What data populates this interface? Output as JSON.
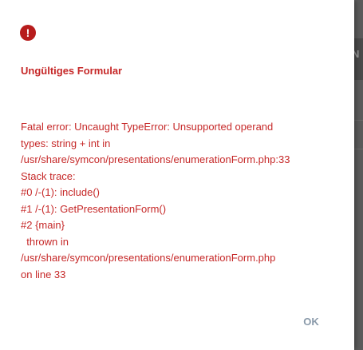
{
  "background": {
    "partial_label": "N"
  },
  "dialog": {
    "icon": "alert-circle-icon",
    "icon_glyph": "!",
    "title": "Ungültiges Formular",
    "message": "Fatal error: Uncaught TypeError: Unsupported operand\ntypes: string + int in\n/usr/share/symcon/presentations/enumerationForm.php:33\nStack trace:\n#0 /-(1): include()\n#1 /-(1): GetPresentationForm()\n#2 {main}\n  thrown in\n/usr/share/symcon/presentations/enumerationForm.php\non line 33",
    "ok_label": "OK"
  },
  "colors": {
    "error_red": "#c62828",
    "icon_red": "#b71c1c",
    "button_text": "#8a9aaa",
    "backdrop": "#5b5b5b"
  }
}
